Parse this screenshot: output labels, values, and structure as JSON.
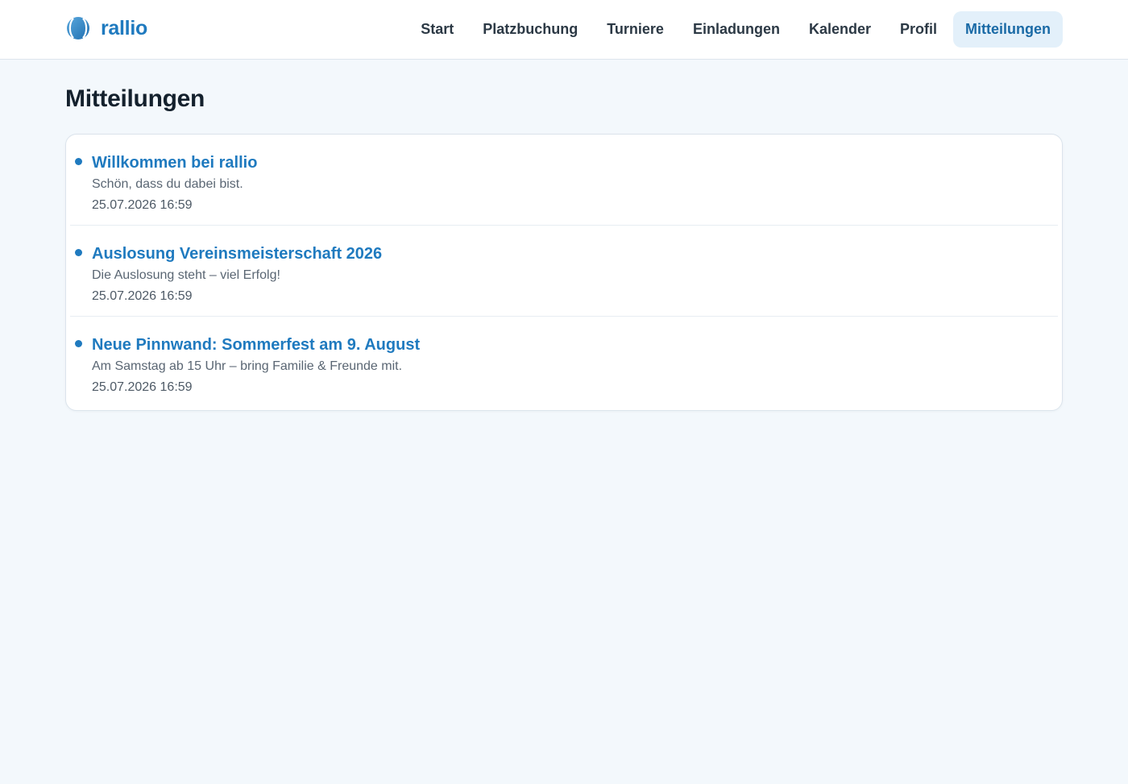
{
  "brand": {
    "name": "rallio",
    "logo_icon": "tennis-ball-icon",
    "accent": "#1f7abf"
  },
  "nav": {
    "items": [
      {
        "label": "Start",
        "active": false
      },
      {
        "label": "Platzbuchung",
        "active": false
      },
      {
        "label": "Turniere",
        "active": false
      },
      {
        "label": "Einladungen",
        "active": false
      },
      {
        "label": "Kalender",
        "active": false
      },
      {
        "label": "Profil",
        "active": false
      },
      {
        "label": "Mitteilungen",
        "active": true
      }
    ]
  },
  "page": {
    "title": "Mitteilungen"
  },
  "messages": [
    {
      "title": "Willkommen bei rallio",
      "body": "Schön, dass du dabei bist.",
      "time": "25.07.2026 16:59",
      "unread": true
    },
    {
      "title": "Auslosung Vereinsmeisterschaft 2026",
      "body": "Die Auslosung steht – viel Erfolg!",
      "time": "25.07.2026 16:59",
      "unread": true
    },
    {
      "title": "Neue Pinnwand: Sommerfest am 9. August",
      "body": "Am Samstag ab 15 Uhr – bring Familie & Freunde mit.",
      "time": "25.07.2026 16:59",
      "unread": true
    }
  ],
  "colors": {
    "background": "#f3f8fc",
    "active_nav_bg": "#e3f0fa",
    "unread_dot": "#1f7abf"
  }
}
